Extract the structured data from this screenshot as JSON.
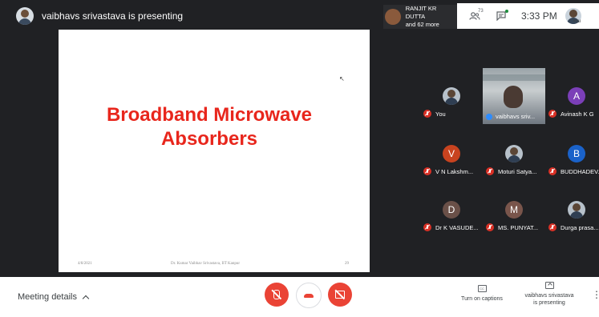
{
  "header": {
    "presenting_text": "vaibhavs srivastava is presenting",
    "top_tile_name_line1": "RANJIT KR DUTTA",
    "top_tile_name_line2": "and 62 more",
    "people_count": "73",
    "time": "3:33 PM",
    "self_label": "You"
  },
  "slide": {
    "title_line1": "Broadband Microwave",
    "title_line2": "Absorbers",
    "footer_date": "4/8/2021",
    "footer_author": "Dr. Kumar Vaibhav Srivastava, IIT Kanpur",
    "footer_page": "29"
  },
  "participants": [
    {
      "name": "You",
      "type": "photo"
    },
    {
      "name": "vaibhavs sriv...",
      "type": "video"
    },
    {
      "name": "Avinash K G",
      "type": "letter",
      "letter": "A",
      "color": "#7b3fb8"
    },
    {
      "name": "V N Lakshm...",
      "type": "letter",
      "letter": "V",
      "color": "#c8431f"
    },
    {
      "name": "Moturi Satya...",
      "type": "photo"
    },
    {
      "name": "BUDDHADEV...",
      "type": "letter",
      "letter": "B",
      "color": "#1a62c9"
    },
    {
      "name": "Dr K VASUDE...",
      "type": "letter",
      "letter": "D",
      "color": "#6a5048"
    },
    {
      "name": "MS. PUNYAT...",
      "type": "letter",
      "letter": "M",
      "color": "#79554b"
    },
    {
      "name": "Durga prasa...",
      "type": "photo"
    }
  ],
  "bottom": {
    "meeting_details": "Meeting details",
    "captions_label": "Turn on captions",
    "captions_icon": "CC",
    "presenting_line1": "vaibhavs srivastava",
    "presenting_line2": "is presenting"
  },
  "colors": {
    "meet_bg": "#202124",
    "danger": "#ea4335",
    "slide_title": "#e8261c"
  }
}
